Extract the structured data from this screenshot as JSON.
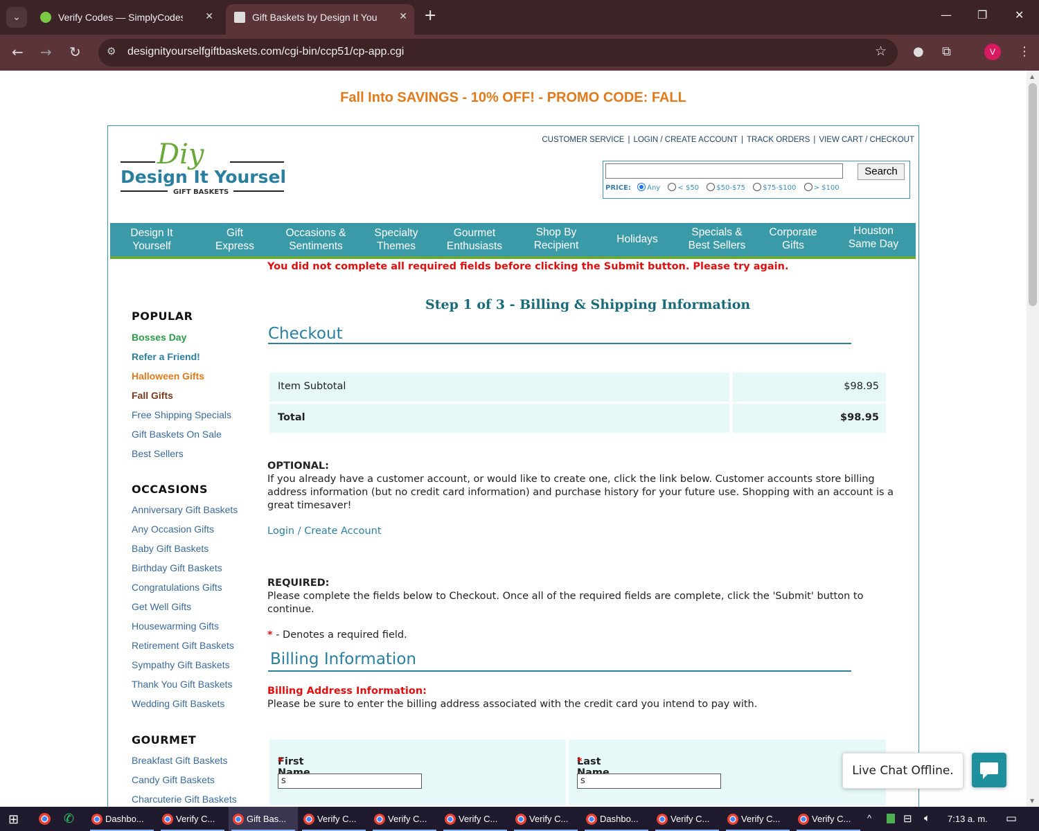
{
  "browser": {
    "tabs": [
      {
        "title": "Verify Codes — SimplyCodes"
      },
      {
        "title": "Gift Baskets by Design It Yourself"
      }
    ],
    "url": "designityourselfgiftbaskets.com/cgi-bin/ccp51/cp-app.cgi",
    "profile_initial": "V"
  },
  "promo": "Fall Into SAVINGS - 10% OFF! - PROMO CODE: FALL",
  "logo": {
    "script": "Diy",
    "name": "Design It Yourself",
    "sub": "GIFT BASKETS"
  },
  "toplinks": {
    "customer_service": "CUSTOMER SERVICE",
    "login": "LOGIN / CREATE ACCOUNT",
    "track": "TRACK ORDERS",
    "cart": "VIEW CART / CHECKOUT"
  },
  "search": {
    "button": "Search",
    "price_label": "PRICE:",
    "options": [
      "Any",
      "< $50",
      "$50-$75",
      "$75-$100",
      "> $100"
    ],
    "selected": "Any"
  },
  "nav": [
    {
      "l1": "Design It",
      "l2": "Yourself"
    },
    {
      "l1": "Gift",
      "l2": "Express"
    },
    {
      "l1": "Occasions &",
      "l2": "Sentiments"
    },
    {
      "l1": "Specialty",
      "l2": "Themes"
    },
    {
      "l1": "Gourmet",
      "l2": "Enthusiasts"
    },
    {
      "l1": "Shop By",
      "l2": "Recipient"
    },
    {
      "l1": "Holidays",
      "l2": ""
    },
    {
      "l1": "Specials &",
      "l2": "Best Sellers"
    },
    {
      "l1": "Corporate",
      "l2": "Gifts"
    },
    {
      "l1": "Houston",
      "l2": "Same Day"
    }
  ],
  "error": "You did not complete all required fields before clicking the Submit button. Please try again.",
  "step": "Step 1 of 3 - Billing & Shipping Information",
  "sidebar": {
    "popular_heading": "POPULAR",
    "popular": [
      "Bosses Day",
      "Refer a Friend!",
      "Halloween Gifts",
      "Fall Gifts",
      "Free Shipping Specials",
      "Gift Baskets On Sale",
      "Best Sellers"
    ],
    "occasions_heading": "OCCASIONS",
    "occasions": [
      "Anniversary Gift Baskets",
      "Any Occasion Gifts",
      "Baby Gift Baskets",
      "Birthday Gift Baskets",
      "Congratulations Gifts",
      "Get Well Gifts",
      "Housewarming Gifts",
      "Retirement Gift Baskets",
      "Sympathy Gift Baskets",
      "Thank You Gift Baskets",
      "Wedding Gift Baskets"
    ],
    "gourmet_heading": "GOURMET",
    "gourmet": [
      "Breakfast Gift Baskets",
      "Candy Gift Baskets",
      "Charcuterie Gift Baskets"
    ]
  },
  "checkout": {
    "title": "Checkout",
    "subtotal_label": "Item Subtotal",
    "subtotal_value": "$98.95",
    "total_label": "Total",
    "total_value": "$98.95",
    "optional_heading": "OPTIONAL:",
    "optional_text": "If you already have a customer account, or would like to create one, click the link below. Customer accounts store billing address information (but no credit card information) and purchase history for your future use. Shopping with an account is a great timesaver!",
    "login_link": "Login / Create Account",
    "required_heading": "REQUIRED:",
    "required_text": "Please complete the fields below to Checkout. Once all of the required fields are complete, click the 'Submit' button to continue.",
    "required_note_star": "*",
    "required_note": " - Denotes a required field."
  },
  "billing": {
    "title": "Billing Information",
    "address_heading": "Billing Address Information:",
    "address_text": "Please be sure to enter the billing address associated with the credit card you intend to pay with.",
    "first_name_label": "First Name",
    "first_name_value": "s",
    "last_name_label": "Last Name",
    "last_name_value": "s"
  },
  "chat": {
    "status": "Live Chat Offline."
  },
  "taskbar": {
    "items": [
      "Dashbo...",
      "Verify C...",
      "Gift Bas...",
      "Verify C...",
      "Verify C...",
      "Verify C...",
      "Verify C...",
      "Dashbo...",
      "Verify C...",
      "Verify C...",
      "Verify C..."
    ],
    "time": "7:13 a. m."
  },
  "colors": {
    "teal": "#3a9aa8",
    "green": "#6aa83a",
    "orange": "#e07a1a",
    "error": "#e01010"
  }
}
